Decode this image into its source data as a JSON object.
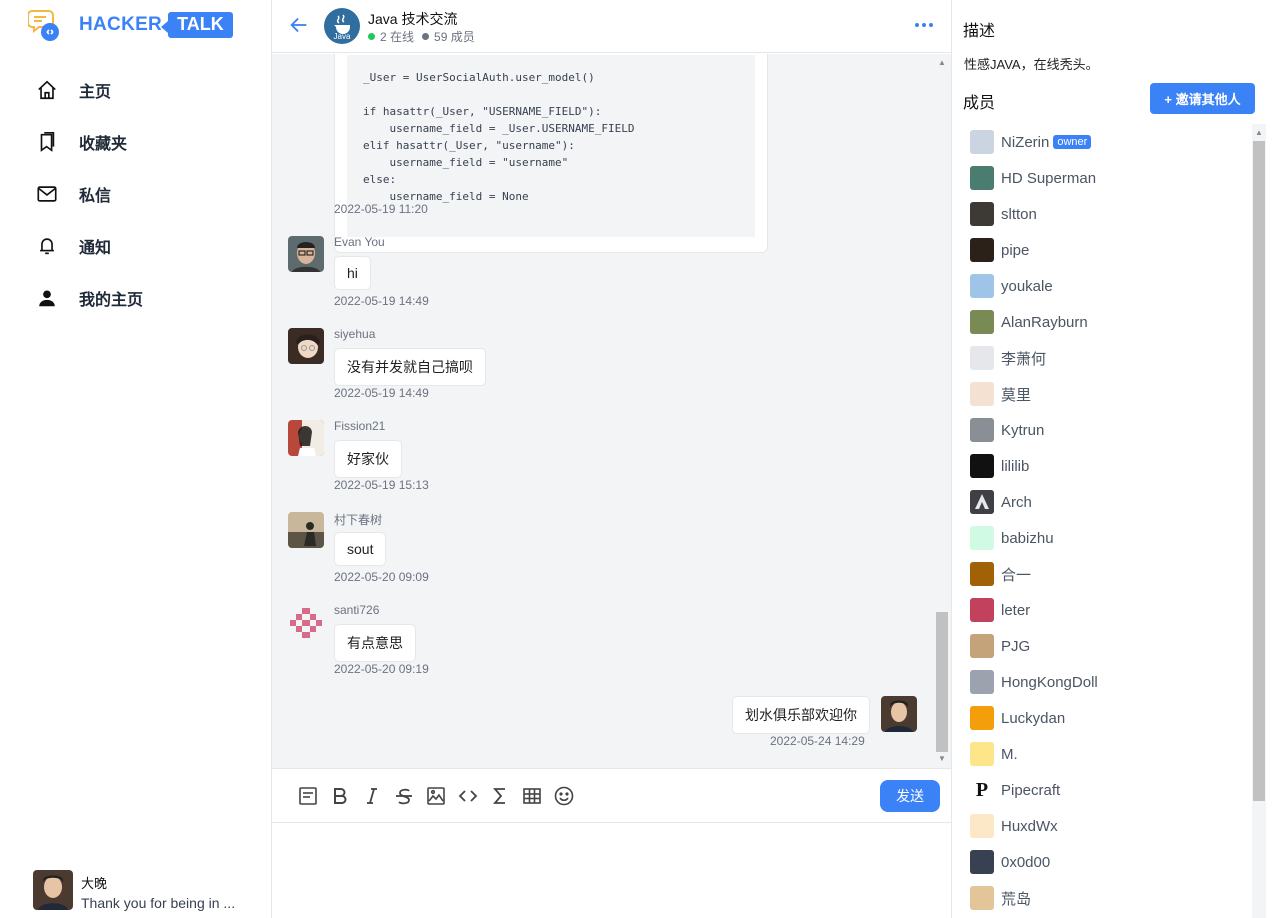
{
  "app": {
    "logo": {
      "word1": "HACKER",
      "word2": "TALK"
    }
  },
  "sidebar": {
    "nav": [
      {
        "label": "主页",
        "icon": "home-icon"
      },
      {
        "label": "收藏夹",
        "icon": "bookmark-icon"
      },
      {
        "label": "私信",
        "icon": "mail-icon"
      },
      {
        "label": "通知",
        "icon": "bell-icon"
      },
      {
        "label": "我的主页",
        "icon": "user-icon"
      }
    ],
    "user": {
      "name": "大晚",
      "bio": "Thank you for being in ..."
    }
  },
  "chat": {
    "title": "Java 技术交流",
    "online": "2 在线",
    "members": "59 成员",
    "online_color": "#22c55e",
    "members_dot_color": "#6b7280",
    "code_lines": "_User = UserSocialAuth.user_model()\n\nif hasattr(_User, \"USERNAME_FIELD\"):\n    username_field = _User.USERNAME_FIELD\nelif hasattr(_User, \"username\"):\n    username_field = \"username\"\nelse:\n    username_field = None",
    "code_time": "2022-05-19 11:20",
    "messages": [
      {
        "name": "Evan You",
        "text": "hi",
        "time": "2022-05-19 14:49"
      },
      {
        "name": "siyehua",
        "text": "没有并发就自己搞呗",
        "time": "2022-05-19 14:49"
      },
      {
        "name": "Fission21",
        "text": "好家伙",
        "time": "2022-05-19 15:13"
      },
      {
        "name": "村下春树",
        "text": "sout",
        "time": "2022-05-20 09:09"
      },
      {
        "name": "santi726",
        "text": "有点意思",
        "time": "2022-05-20 09:19"
      }
    ],
    "own_message": {
      "text": "划水俱乐部欢迎你",
      "time": "2022-05-24 14:29"
    },
    "send_label": "发送",
    "accent": "#3b82f6"
  },
  "panel": {
    "desc_title": "描述",
    "desc_text": "性感JAVA，在线秃头。",
    "members_title": "成员",
    "invite_label": "+ 邀请其他人",
    "owner_badge": "owner",
    "members": [
      "NiZerin",
      "HD Superman",
      "sltton",
      "pipe",
      "youkale",
      "AlanRayburn",
      "李萧何",
      "莫里",
      "Kytrun",
      "lililib",
      "Arch",
      "babizhu",
      "合一",
      "leter",
      "PJG",
      "HongKongDoll",
      "Luckydan",
      "M.",
      "Pipecraft",
      "HuxdWx",
      "0x0d00",
      "荒岛"
    ]
  }
}
